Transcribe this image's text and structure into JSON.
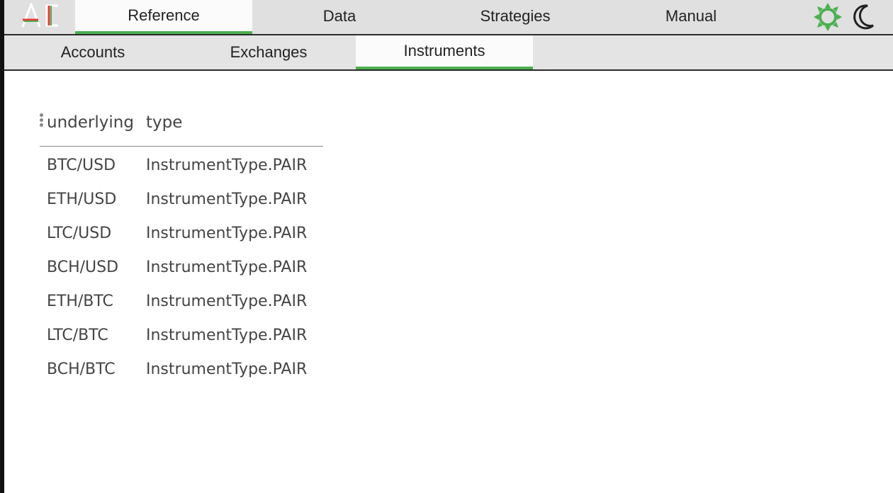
{
  "app": {
    "nav_tabs": [
      {
        "label": "Reference",
        "active": true
      },
      {
        "label": "Data",
        "active": false
      },
      {
        "label": "Strategies",
        "active": false
      },
      {
        "label": "Manual",
        "active": false
      }
    ],
    "sub_tabs": [
      {
        "label": "Accounts",
        "active": false
      },
      {
        "label": "Exchanges",
        "active": false
      },
      {
        "label": "Instruments",
        "active": true
      }
    ],
    "icons": [
      "logo-ac-icon",
      "sun-icon",
      "moon-icon",
      "kebab-menu-icon"
    ],
    "colors": {
      "accent": "#4caf50",
      "logo_red": "#e53935",
      "bar_bg": "#e0e0e0"
    }
  },
  "grid": {
    "columns": [
      "underlying",
      "type"
    ],
    "rows": [
      [
        "BTC/USD",
        "InstrumentType.PAIR"
      ],
      [
        "ETH/USD",
        "InstrumentType.PAIR"
      ],
      [
        "LTC/USD",
        "InstrumentType.PAIR"
      ],
      [
        "BCH/USD",
        "InstrumentType.PAIR"
      ],
      [
        "ETH/BTC",
        "InstrumentType.PAIR"
      ],
      [
        "LTC/BTC",
        "InstrumentType.PAIR"
      ],
      [
        "BCH/BTC",
        "InstrumentType.PAIR"
      ]
    ]
  }
}
